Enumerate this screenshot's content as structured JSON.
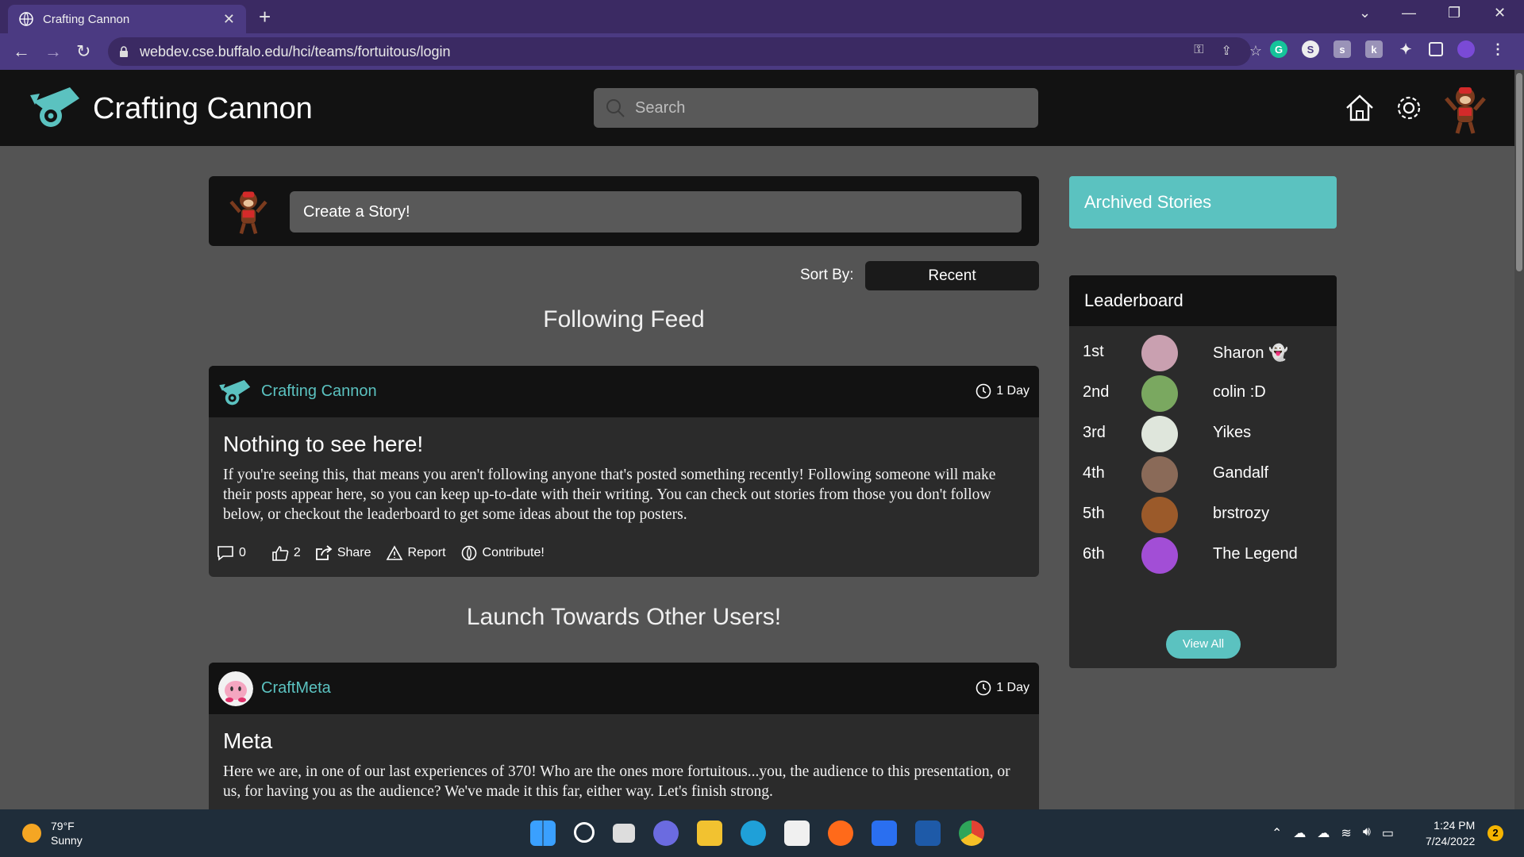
{
  "browser": {
    "tab_title": "Crafting Cannon",
    "url": "webdev.cse.buffalo.edu/hci/teams/fortuitous/login"
  },
  "header": {
    "brand": "Crafting Cannon",
    "search_placeholder": "Search"
  },
  "create": {
    "label": "Create a Story!"
  },
  "sort": {
    "label": "Sort By:",
    "value": "Recent"
  },
  "sections": {
    "following": "Following Feed",
    "launch": "Launch Towards Other Users!"
  },
  "posts": [
    {
      "author": "Crafting Cannon",
      "time": "1 Day",
      "title": "Nothing to see here!",
      "text": "If you're seeing this, that means you aren't following anyone that's posted something recently! Following someone will make their posts appear here, so you can keep up-to-date with their writing. You can check out stories from those you don't follow below, or checkout the leaderboard to get some ideas about the top posters.",
      "comments": "0",
      "likes": "2",
      "share": "Share",
      "report": "Report",
      "contribute": "Contribute!"
    },
    {
      "author": "CraftMeta",
      "time": "1 Day",
      "title": "Meta",
      "text": "Here we are, in one of our last experiences of 370! Who are the ones more fortuitous...you, the audience to this presentation, or us, for having you as the audience? We've made it this far, either way. Let's finish strong."
    }
  ],
  "archived": {
    "label": "Archived Stories"
  },
  "leaderboard": {
    "title": "Leaderboard",
    "rows": [
      {
        "rank": "1st",
        "name": "Sharon 👻",
        "color": "#c9a0b0"
      },
      {
        "rank": "2nd",
        "name": "colin :D",
        "color": "#7aa860"
      },
      {
        "rank": "3rd",
        "name": "Yikes",
        "color": "#dfe6dc"
      },
      {
        "rank": "4th",
        "name": "Gandalf",
        "color": "#8a6a58"
      },
      {
        "rank": "5th",
        "name": "brstrozy",
        "color": "#9b5a2a"
      },
      {
        "rank": "6th",
        "name": "The Legend",
        "color": "#a24ed6"
      }
    ],
    "view_all": "View All"
  },
  "taskbar": {
    "temp": "79°F",
    "condition": "Sunny",
    "time": "1:24 PM",
    "date": "7/24/2022",
    "notifications": "2"
  },
  "colors": {
    "accent": "#5bc2c0",
    "header": "#121212",
    "card": "#2b2b2b",
    "page": "#545454"
  }
}
